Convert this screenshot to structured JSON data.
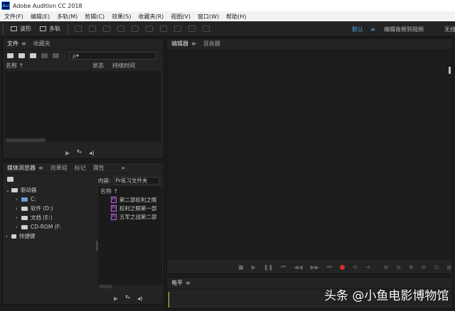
{
  "window": {
    "title": "Adobe Audition CC 2018",
    "logo": "Au"
  },
  "menu": [
    "文件(F)",
    "编辑(E)",
    "多轨(M)",
    "剪辑(C)",
    "效果(S)",
    "收藏夹(R)",
    "视图(V)",
    "窗口(W)",
    "帮助(H)"
  ],
  "toolbar": {
    "waveform": "波形",
    "multitrack": "多轨",
    "workspace_default": "默认",
    "workspace_menu": "≡",
    "workspace_edit_video": "编辑音频到视频",
    "workspace_no_effects": "无线"
  },
  "files_panel": {
    "tab_files": "文件",
    "tab_favorites": "收藏夹",
    "search_placeholder": "ρ▾",
    "col_name": "名称 ↑",
    "col_status": "状态",
    "col_duration": "持续时间"
  },
  "media_browser": {
    "tab_media": "媒体浏览器",
    "tab_effects": "效果组",
    "tab_markers": "标记",
    "tab_properties": "属性",
    "more": "»",
    "content_label": "内容:",
    "content_value": "Pr练习文件夹",
    "tree": {
      "drives": "驱动器",
      "c": "C:",
      "d": "软件 (D:)",
      "e": "文档 (E:)",
      "f": "CD-ROM (F:",
      "shortcuts": "快捷键"
    },
    "col_name": "名称 ↑",
    "files": [
      "第二部权利之眼",
      "权利之眼第一部",
      "五军之战第二部"
    ]
  },
  "editor": {
    "tab_editor": "编辑器",
    "tab_mixer": "混音器"
  },
  "levels": {
    "tab": "电平"
  },
  "watermark": "头条 @小鱼电影博物馆",
  "colors": {
    "accent": "#2fa8e0",
    "record": "#d03030",
    "premiere": "#b36ad9"
  }
}
